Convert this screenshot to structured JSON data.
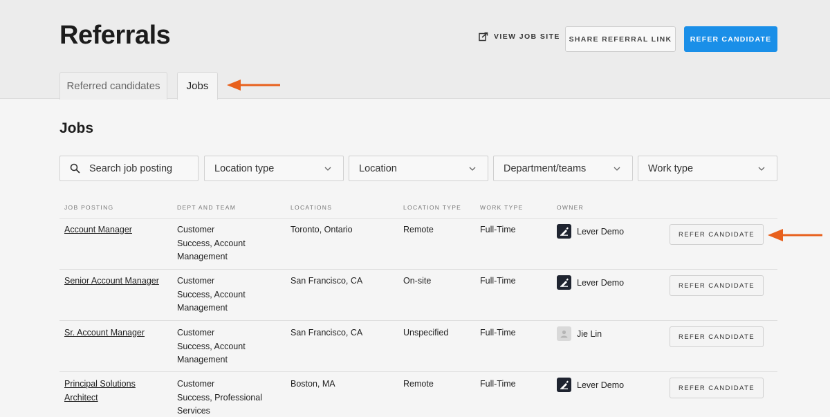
{
  "header": {
    "title": "Referrals",
    "view_job_site": "VIEW JOB SITE",
    "share_referral_link": "SHARE REFERRAL LINK",
    "refer_candidate": "REFER CANDIDATE"
  },
  "tabs": [
    {
      "label": "Referred candidates",
      "active": false
    },
    {
      "label": "Jobs",
      "active": true
    }
  ],
  "section_title": "Jobs",
  "filters": {
    "search_placeholder": "Search job posting",
    "location_type": "Location type",
    "location": "Location",
    "department": "Department/teams",
    "work_type": "Work type"
  },
  "table": {
    "columns": [
      "JOB POSTING",
      "DEPT AND TEAM",
      "LOCATIONS",
      "LOCATION TYPE",
      "WORK TYPE",
      "OWNER"
    ],
    "refer_label": "REFER CANDIDATE",
    "rows": [
      {
        "job_line1": "Account Manager",
        "job_line2": "",
        "dept_line1": "Customer",
        "dept_line2": "Success, Account",
        "dept_line3": "Management",
        "location": "Toronto, Ontario",
        "location_type": "Remote",
        "work_type": "Full-Time",
        "owner": "Lever Demo",
        "owner_avatar": "lever-logo"
      },
      {
        "job_line1": "Senior Account Manager",
        "job_line2": "",
        "dept_line1": "Customer",
        "dept_line2": "Success, Account",
        "dept_line3": "Management",
        "location": "San Francisco, CA",
        "location_type": "On-site",
        "work_type": "Full-Time",
        "owner": "Lever Demo",
        "owner_avatar": "lever-logo"
      },
      {
        "job_line1": "Sr. Account Manager",
        "job_line2": "",
        "dept_line1": "Customer",
        "dept_line2": "Success, Account",
        "dept_line3": "Management",
        "location": "San Francisco, CA",
        "location_type": "Unspecified",
        "work_type": "Full-Time",
        "owner": "Jie Lin",
        "owner_avatar": "default-user"
      },
      {
        "job_line1": "Principal Solutions",
        "job_line2": "Architect",
        "dept_line1": "Customer",
        "dept_line2": "Success, Professional",
        "dept_line3": "Services",
        "location": "Boston, MA",
        "location_type": "Remote",
        "work_type": "Full-Time",
        "owner": "Lever Demo",
        "owner_avatar": "lever-logo"
      }
    ]
  },
  "colors": {
    "primary": "#1a8fe8",
    "annotation_arrow": "#e8601c"
  }
}
